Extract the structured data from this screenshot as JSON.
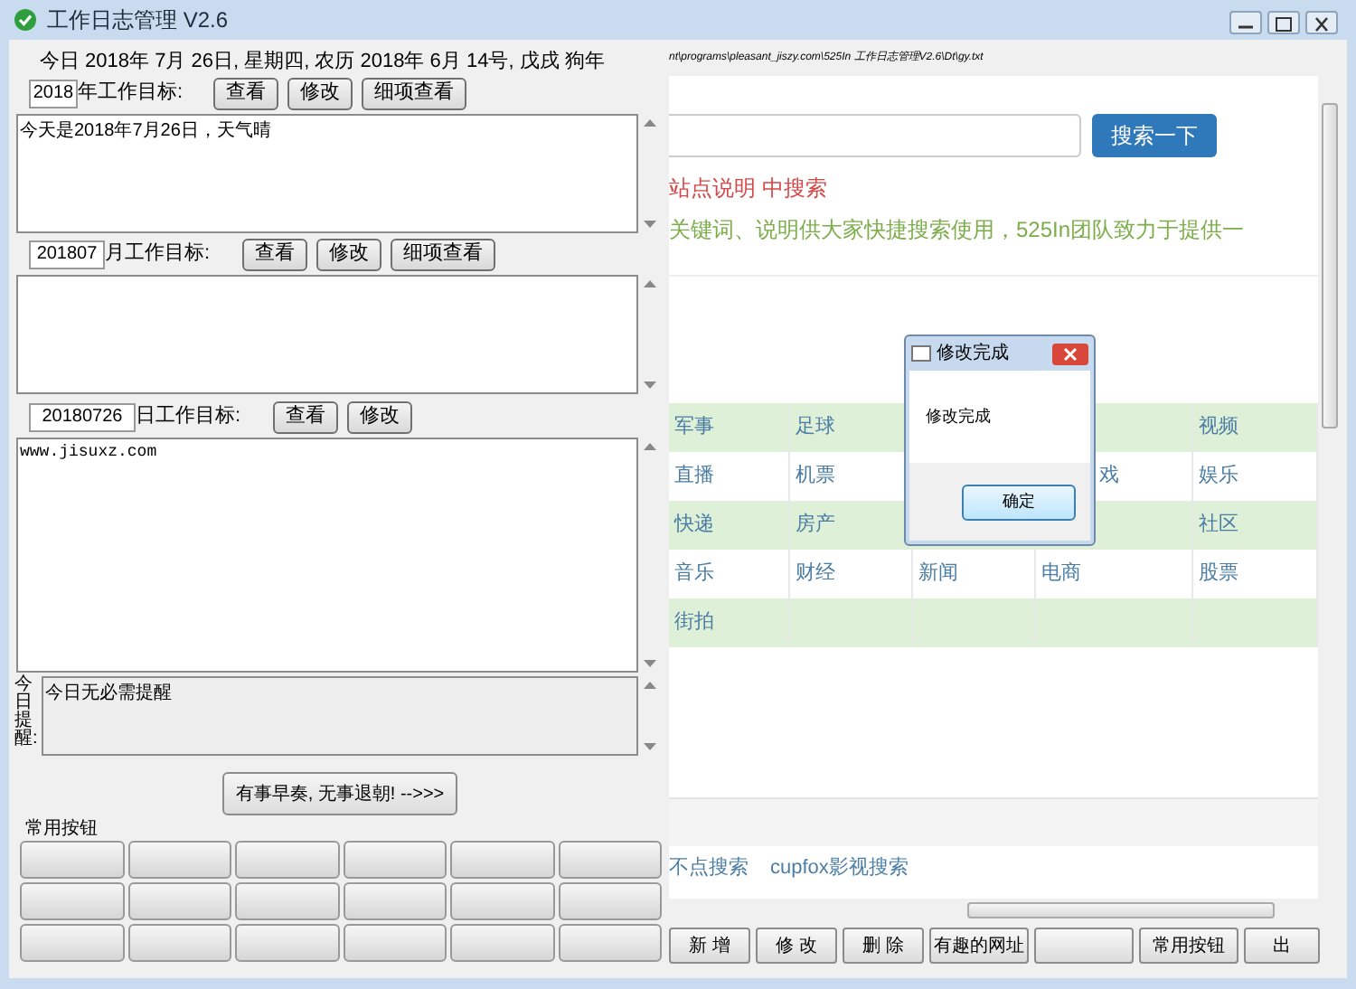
{
  "window": {
    "title": "工作日志管理 V2.6"
  },
  "date_line": "今日 2018年 7月 26日, 星期四, 农历 2018年 6月 14号, 戊戌 狗年",
  "goals": [
    {
      "kind": "year",
      "value": "2018",
      "label": "年工作目标:",
      "buttons": [
        "查看",
        "修改",
        "细项查看"
      ],
      "text": "今天是2018年7月26日，天气晴"
    },
    {
      "kind": "month",
      "value": "201807",
      "label": "月工作目标:",
      "buttons": [
        "查看",
        "修改",
        "细项查看"
      ]
    },
    {
      "kind": "day",
      "value": "20180726",
      "label": "日工作目标:",
      "buttons": [
        "查看",
        "修改"
      ],
      "text": "www.jisuxz.com"
    }
  ],
  "reminder": {
    "label": "今日提醒:",
    "text": "今日无必需提醒"
  },
  "court_button": "有事早奏, 无事退朝! -->>>",
  "common_buttons": {
    "title": "常用按钮"
  },
  "browser": {
    "path": "nt\\programs\\pleasant_jiszy.com\\525In 工作日志管理V2.6\\Dt\\gy.txt",
    "search_button": "搜索一下",
    "notice": "站点说明  中搜索",
    "intro": "关键词、说明供大家快捷搜索使用，525In团队致力于提供一",
    "table": [
      {
        "column_1": "军事",
        "column_2": "足球",
        "column_5": "视频"
      },
      {
        "column_1": "直播",
        "column_2": "机票",
        "column_4": {
          "text": "戏",
          "kind": "partial"
        },
        "column_5": "娱乐"
      },
      {
        "column_1": "快递",
        "column_2": "房产",
        "column_5": "社区"
      },
      {
        "column_1": "音乐",
        "column_2": "财经",
        "column_3": "新闻",
        "column_4": "电商",
        "column_5": "股票"
      },
      {
        "column_1": "街拍"
      }
    ],
    "links": [
      "不点搜索",
      "cupfox影视搜索"
    ]
  },
  "toolbar": [
    {
      "kind": "labeled",
      "label": "新 增"
    },
    {
      "kind": "labeled",
      "label": "修 改"
    },
    {
      "kind": "labeled",
      "label": "删 除"
    },
    {
      "kind": "labeled",
      "label": "有趣的网址"
    },
    {
      "kind": "blank"
    },
    {
      "kind": "labeled",
      "label": "常用按钮"
    },
    {
      "kind": "labeled",
      "label": "出"
    }
  ],
  "dialog": {
    "title": "修改完成",
    "message": "修改完成",
    "button": "确定"
  }
}
